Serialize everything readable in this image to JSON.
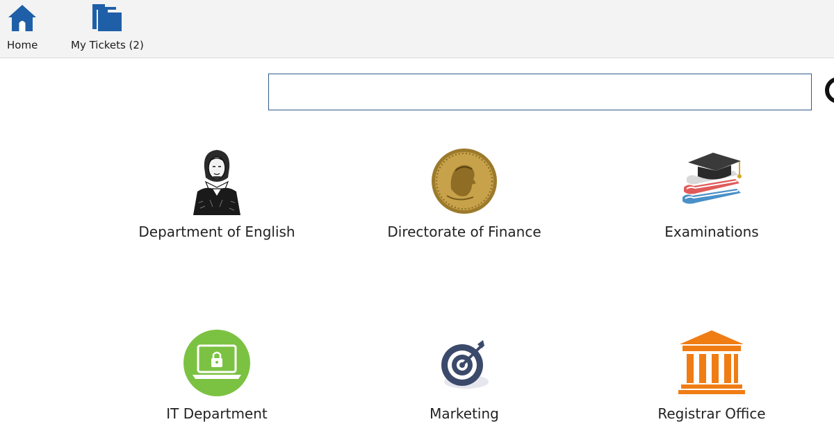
{
  "toolbar": {
    "home_label": "Home",
    "tickets_label": "My Tickets (2)"
  },
  "search": {
    "value": "",
    "placeholder": ""
  },
  "colors": {
    "nav_icon_blue": "#1f5fa8",
    "search_border": "#2c5a8c",
    "it_green": "#7cc242",
    "registrar_orange": "#f07d14",
    "marketing_navy": "#3b4a6b"
  },
  "departments": [
    {
      "label": "Department of English",
      "icon": "shakespeare-portrait-icon"
    },
    {
      "label": "Directorate of Finance",
      "icon": "gold-coin-icon"
    },
    {
      "label": "Examinations",
      "icon": "graduation-cap-books-icon"
    },
    {
      "label": "IT Department",
      "icon": "locked-laptop-icon"
    },
    {
      "label": "Marketing",
      "icon": "target-icon"
    },
    {
      "label": "Registrar Office",
      "icon": "courthouse-icon"
    }
  ]
}
